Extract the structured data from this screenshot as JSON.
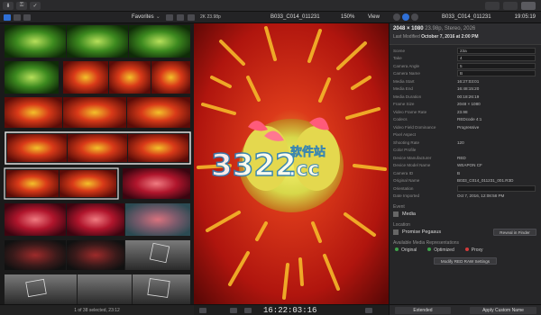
{
  "toolbar": {
    "left_icons": [
      "import-icon",
      "key-icon",
      "check-icon"
    ]
  },
  "subbar": {
    "favorites": "Favorites",
    "resolution": "2K 23.98p",
    "clip_name": "B033_C014_011231",
    "zoom": "150%",
    "view": "View",
    "inspector_title": "B033_C014_011231",
    "time": "19:05:19"
  },
  "browser": {
    "footer": "1 of 38 selected, 23:12"
  },
  "viewer": {
    "timecode": "16:22:03:16"
  },
  "inspector": {
    "clip_line": "2048 × 1080",
    "clip_sub": "23.98p, Stereo, 2026",
    "modified_label": "Last Modified",
    "modified_value": "October 7, 2016 at 2:00 PM",
    "properties": [
      {
        "k": "Scene",
        "v": "23a",
        "box": true
      },
      {
        "k": "Take",
        "v": "4",
        "box": true
      },
      {
        "k": "Camera Angle",
        "v": "5",
        "box": true
      },
      {
        "k": "Camera Name",
        "v": "B",
        "box": true
      },
      {
        "k": "Media Start",
        "v": "16:27:03:01",
        "box": false
      },
      {
        "k": "Media End",
        "v": "16:48:15:20",
        "box": false
      },
      {
        "k": "Media Duration",
        "v": "00:18:26:19",
        "box": false
      },
      {
        "k": "Frame Size",
        "v": "2048 × 1080",
        "box": false
      },
      {
        "k": "Video Frame Rate",
        "v": "23.98",
        "box": false
      },
      {
        "k": "Codecs",
        "v": "REDcode 4:1",
        "box": false
      },
      {
        "k": "Video Field Dominance",
        "v": "Progressive",
        "box": false
      },
      {
        "k": "Pixel Aspect",
        "v": "",
        "box": false
      },
      {
        "k": "Shooting Rate",
        "v": "120",
        "box": false
      },
      {
        "k": "Color Profile",
        "v": "",
        "box": false
      },
      {
        "k": "Device Manufacturer",
        "v": "RED",
        "box": false
      },
      {
        "k": "Device Model Name",
        "v": "WEAPON CF",
        "box": false
      },
      {
        "k": "Camera ID",
        "v": "B",
        "box": false
      },
      {
        "k": "Original Name",
        "v": "B033_C014_011231_001.R3D",
        "box": false
      },
      {
        "k": "Orientation",
        "v": "",
        "box": true
      },
      {
        "k": "Date Imported",
        "v": "Oct 7, 2016, 12:08:58 PM",
        "box": false
      }
    ],
    "event_label": "Event",
    "event_value": "Media",
    "location_label": "Location",
    "location_value": "Promise Pegasus",
    "reveal_label": "Reveal in Finder",
    "reps_label": "Available Media Representations",
    "reps": [
      {
        "label": "Original",
        "color": "#3ea24a"
      },
      {
        "label": "Optimized",
        "color": "#3ea24a"
      },
      {
        "label": "Proxy",
        "color": "#d23b3b"
      }
    ],
    "modify_btn": "Modify RED RAW Settings",
    "extended": "Extended",
    "apply": "Apply Custom Name"
  },
  "watermark": {
    "number": "3322",
    "suffix": ".cc",
    "cn": "软件站"
  }
}
